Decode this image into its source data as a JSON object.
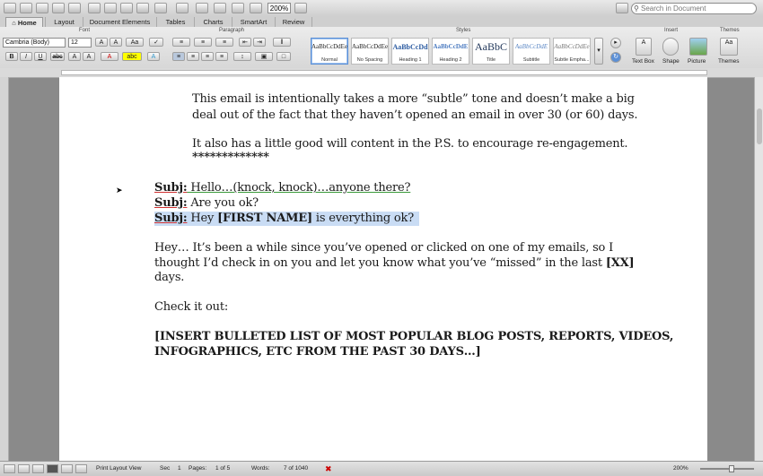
{
  "toolbar": {
    "zoom": "200%",
    "search_placeholder": "Search in Document"
  },
  "tabs": [
    "Home",
    "Layout",
    "Document Elements",
    "Tables",
    "Charts",
    "SmartArt",
    "Review"
  ],
  "ribbon": {
    "groups": {
      "font": "Font",
      "paragraph": "Paragraph",
      "styles": "Styles",
      "insert": "Insert",
      "themes": "Themes"
    },
    "font_name": "Cambria (Body)",
    "font_size": "12",
    "styles": [
      {
        "sample": "AaBbCcDdEe",
        "name": "Normal"
      },
      {
        "sample": "AaBbCcDdEe",
        "name": "No Spacing"
      },
      {
        "sample": "AaBbCcDd",
        "name": "Heading 1"
      },
      {
        "sample": "AaBbCcDdE",
        "name": "Heading 2"
      },
      {
        "sample": "AaBbC",
        "name": "Title"
      },
      {
        "sample": "AaBbCcDdE",
        "name": "Subtitle"
      },
      {
        "sample": "AaBbCcDdEe",
        "name": "Subtle Empha..."
      }
    ],
    "insert": {
      "text_box": "Text Box",
      "shape": "Shape",
      "picture": "Picture"
    },
    "themes_label": "Themes"
  },
  "document": {
    "p1": "This email is intentionally takes a more “subtle” tone and doesn’t make a big",
    "p1b": "deal out of the fact that they haven’t opened an email in over 30 (or 60) days.",
    "p2": "It also has a little good will content in the P.S. to encourage re-engagement.",
    "stars": "*************",
    "subj_label": "Subj:",
    "subj1": " Hello…(knock, knock)…anyone there?",
    "subj2": " Are you ok?",
    "subj3a": " Hey ",
    "subj3b": "[FIRST NAME]",
    "subj3c": " is everything ok?",
    "body1": "Hey… It’s been a while since you’ve opened or clicked on one of my emails, so I",
    "body2a": "thought I’d check in on you and let you know what you’ve “missed” in the last ",
    "body2b": "[XX]",
    "body3": "days.",
    "check": "Check it out:",
    "insert1": "[INSERT BULLETED LIST OF MOST POPULAR BLOG POSTS, REPORTS, VIDEOS,",
    "insert2": "INFOGRAPHICS, ETC FROM THE PAST 30 DAYS…]"
  },
  "status": {
    "view": "Print Layout View",
    "sec_label": "Sec",
    "sec": "1",
    "pages_label": "Pages:",
    "pages": "1 of 5",
    "words_label": "Words:",
    "words": "7 of 1040",
    "zoom": "200%"
  }
}
